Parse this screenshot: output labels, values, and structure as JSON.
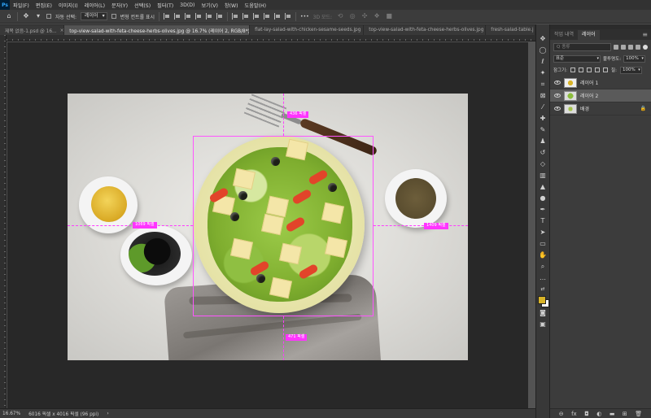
{
  "menubar": {
    "logo": "Ps",
    "items": [
      "파일(F)",
      "편집(E)",
      "이미지(I)",
      "레이어(L)",
      "문자(Y)",
      "선택(S)",
      "필터(T)",
      "3D(D)",
      "보기(V)",
      "창(W)",
      "도움말(H)"
    ]
  },
  "options": {
    "auto_select_label": "자동 선택:",
    "auto_select_value": "레이어",
    "transform_label": "변형 컨트롤 표시",
    "mode3d_label": "3D 모드:",
    "more_label": "•••"
  },
  "tabs": [
    {
      "label": "제목 없음-1.psd @ 16...",
      "active": false
    },
    {
      "label": "top-view-salad-with-feta-cheese-herbs-olives.jpg @ 16.7% (레이어 2, RGB/8*) *",
      "active": true
    },
    {
      "label": "flat-lay-salad-with-chicken-sesame-seeds.jpg",
      "active": false
    },
    {
      "label": "top-view-salad-with-feta-cheese-herbs-olives.jpg",
      "active": false
    },
    {
      "label": "fresh-salad-table.j",
      "active": false
    }
  ],
  "canvas": {
    "measurements": {
      "top": "436 픽셀",
      "left": "1069 픽셀",
      "right": "1409 픽셀",
      "bottom": "471 픽셀"
    }
  },
  "status": {
    "zoom": "16.67%",
    "doc_size": "6016 픽셀 x 4016 픽셀 (96 ppi)",
    "arrow": "›"
  },
  "layers_panel": {
    "tabs": [
      "작업 내역",
      "레이어"
    ],
    "active_tab": "레이어",
    "search_placeholder": "종류",
    "search_prefix": "Q",
    "blend_mode": "표준",
    "opacity_label": "불투명도:",
    "opacity_value": "100%",
    "lock_label": "잠그기:",
    "fill_label": "칠:",
    "fill_value": "100%",
    "layers": [
      {
        "name": "레이어 1",
        "selected": false
      },
      {
        "name": "레이어 2",
        "selected": true
      },
      {
        "name": "배경",
        "selected": false
      }
    ],
    "footer_icons": [
      "link-icon",
      "fx-icon",
      "mask-icon",
      "adjustment-icon",
      "group-icon",
      "new-layer-icon",
      "trash-icon"
    ],
    "footer_glyphs": [
      "⊖",
      "fx",
      "◘",
      "◐",
      "▬",
      "⊞",
      "🗑"
    ]
  }
}
